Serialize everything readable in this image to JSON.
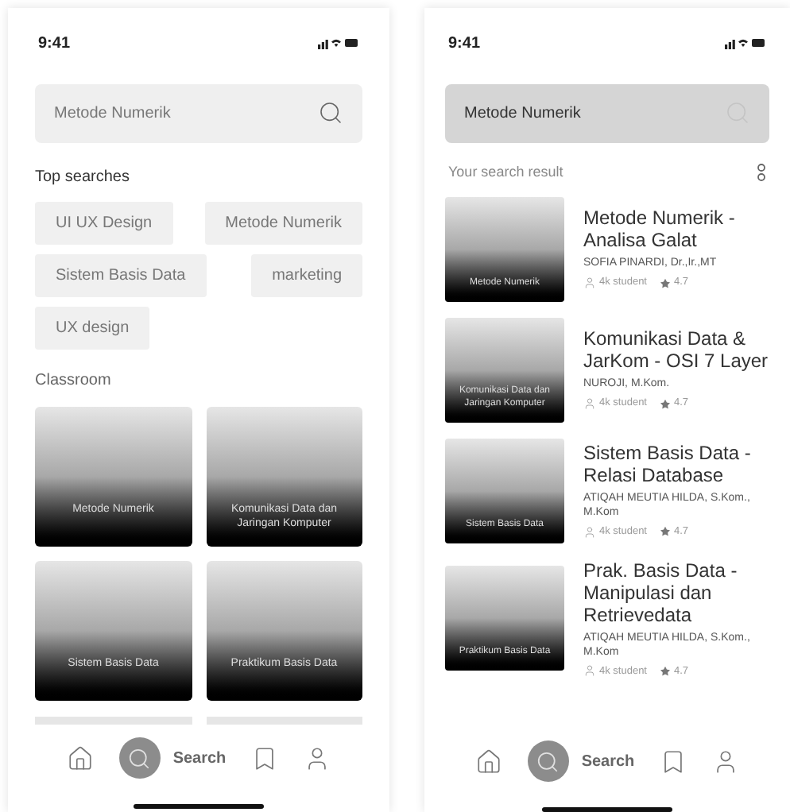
{
  "search_screen": {
    "status_bar": {
      "time": "9:41"
    },
    "search": {
      "placeholder": "Metode Numerik"
    },
    "top_searches": {
      "title": "Top searches",
      "chips": [
        {
          "label": "UI UX Design"
        },
        {
          "label": "Metode Numerik"
        },
        {
          "label": "Sistem Basis Data"
        },
        {
          "label": "marketing"
        },
        {
          "label": "UX design"
        }
      ]
    },
    "classroom": {
      "title": "Classroom",
      "cards": [
        {
          "title": "Metode Numerik"
        },
        {
          "title": "Komunikasi Data dan Jaringan Komputer"
        },
        {
          "title": "Sistem Basis Data"
        },
        {
          "title": "Praktikum Basis Data"
        }
      ]
    },
    "nav": [
      {
        "selected": false
      },
      {
        "selected": true,
        "label": "Search"
      },
      {
        "selected": false
      },
      {
        "selected": false
      }
    ]
  },
  "result_screen": {
    "status_bar": {
      "time": "9:41"
    },
    "search": {
      "value": "Metode Numerik"
    },
    "results_title": "Your search result",
    "results": [
      {
        "thumbnail": "Metode Numerik",
        "title": "Metode Numerik - Analisa Galat",
        "author": "SOFIA PINARDI, Dr.,Ir.,MT",
        "students": "4k student",
        "rating": "4.7"
      },
      {
        "thumbnail": "Komunikasi Data dan Jaringan Komputer",
        "title": "Komunikasi Data & JarKom - OSI 7 Layer",
        "author": "NUROJI, M.Kom.",
        "students": "4k student",
        "rating": "4.7"
      },
      {
        "thumbnail": "Sistem Basis Data",
        "title": "Sistem Basis Data - Relasi Database",
        "author": "ATIQAH MEUTIA HILDA, S.Kom., M.Kom",
        "students": "4k student",
        "rating": "4.7"
      },
      {
        "thumbnail": "Praktikum Basis Data",
        "title": "Prak. Basis Data - Manipulasi dan Retrievedata",
        "author": "ATIQAH MEUTIA HILDA, S.Kom., M.Kom",
        "students": "4k student",
        "rating": "4.7"
      }
    ],
    "nav": [
      {
        "selected": false
      },
      {
        "selected": true,
        "label": "Search"
      },
      {
        "selected": false
      },
      {
        "selected": false
      }
    ]
  }
}
